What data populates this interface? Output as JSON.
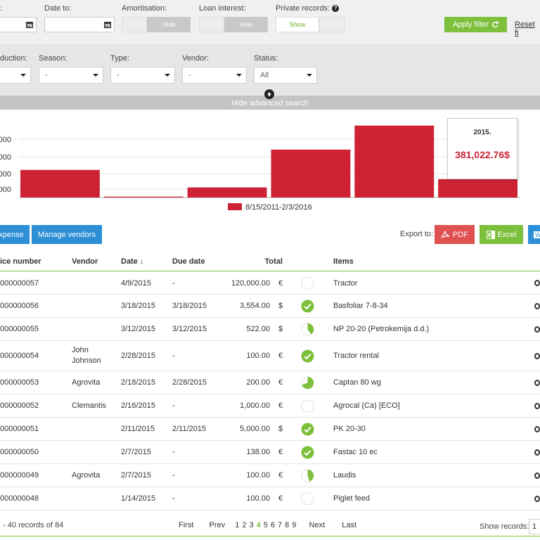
{
  "filters": {
    "date_from_label": ":",
    "date_to_label": "Date to:",
    "amortisation_label": "Amortisation:",
    "amortisation_value": "Hide",
    "loan_interest_label": "Loan interest:",
    "loan_interest_value": "Hide",
    "private_records_label": "Private records:",
    "private_records_value": "Show",
    "apply_label": "Apply filter",
    "reset_label": "Reset fi"
  },
  "advanced": {
    "production_label": "duction:",
    "season_label": "Season:",
    "season_value": "-",
    "type_label": "Type:",
    "type_value": "-",
    "vendor_label": "Vendor:",
    "vendor_value": "-",
    "status_label": "Status:",
    "status_value": "All",
    "hide_label": "Hide advanced search"
  },
  "colors": {
    "accent_green": "#7cc03c",
    "bar_red": "#cc2233",
    "blue": "#2d8fd5",
    "pdf_red": "#e05252"
  },
  "chart_data": {
    "type": "bar",
    "series": [
      {
        "name": "8/15/2011-2/3/2016",
        "values": [
          150000,
          5000,
          55000,
          260000,
          390000,
          100000
        ]
      }
    ],
    "ytick_labels": [
      "000",
      "000",
      "000",
      "000"
    ],
    "tooltip": {
      "year": "2015.",
      "value": "381,022.76$"
    },
    "legend": "8/15/2011-2/3/2016",
    "legend_position": "bottom",
    "grid": true
  },
  "actions": {
    "add_expense_label": "xpense",
    "manage_vendors_label": "Manage vendors",
    "export_label": "Export to:",
    "pdf_label": "PDF",
    "excel_label": "Excel",
    "word_label": "W"
  },
  "table": {
    "headers": {
      "invoice": "ice number",
      "vendor": "Vendor",
      "date": "Date ↓",
      "due": "Due date",
      "total": "Total",
      "items": "Items"
    },
    "rows": [
      {
        "invoice": "000000057",
        "vendor": "",
        "date": "4/9/2015",
        "due": "-",
        "total": "120,000.00",
        "cur": "€",
        "status": "empty",
        "items": "Tractor"
      },
      {
        "invoice": "000000056",
        "vendor": "",
        "date": "3/18/2015",
        "due": "3/18/2015",
        "total": "3,554.00",
        "cur": "$",
        "status": "check",
        "items": "Basfoliar 7-8-34"
      },
      {
        "invoice": "000000055",
        "vendor": "",
        "date": "3/12/2015",
        "due": "3/12/2015",
        "total": "522.00",
        "cur": "$",
        "status": "partial-40",
        "items": "NP 20-20 (Petrokemija d.d.)"
      },
      {
        "invoice": "000000054",
        "vendor": "John Johnson",
        "date": "2/28/2015",
        "due": "-",
        "total": "100.00",
        "cur": "€",
        "status": "check",
        "items": "Tractor rental"
      },
      {
        "invoice": "000000053",
        "vendor": "Agrovita",
        "date": "2/18/2015",
        "due": "2/28/2015",
        "total": "200.00",
        "cur": "€",
        "status": "partial-70",
        "items": "Captan 80 wg"
      },
      {
        "invoice": "000000052",
        "vendor": "Clemantis",
        "date": "2/16/2015",
        "due": "-",
        "total": "1,000.00",
        "cur": "€",
        "status": "empty",
        "items": "Agrocal (Ca) [ECO]"
      },
      {
        "invoice": "000000051",
        "vendor": "",
        "date": "2/11/2015",
        "due": "2/11/2015",
        "total": "5,000.00",
        "cur": "$",
        "status": "check",
        "items": "PK 20-30"
      },
      {
        "invoice": "000000050",
        "vendor": "",
        "date": "2/7/2015",
        "due": "-",
        "total": "138.00",
        "cur": "€",
        "status": "check",
        "items": "Fastac 10 ec"
      },
      {
        "invoice": "000000049",
        "vendor": "Agrovita",
        "date": "2/7/2015",
        "due": "-",
        "total": "100.00",
        "cur": "€",
        "status": "partial-45",
        "items": "Laudis"
      },
      {
        "invoice": "000000048",
        "vendor": "",
        "date": "1/14/2015",
        "due": "-",
        "total": "100.00",
        "cur": "€",
        "status": "empty",
        "items": "Piglet feed"
      }
    ]
  },
  "footer": {
    "records": "- 40 records of 84",
    "first": "First",
    "prev": "Prev",
    "pages": [
      "1",
      "2",
      "3",
      "4",
      "5",
      "6",
      "7",
      "8",
      "9"
    ],
    "current_page": "4",
    "next": "Next",
    "last": "Last",
    "show_records_label": "Show records:",
    "show_records_value": "1"
  }
}
